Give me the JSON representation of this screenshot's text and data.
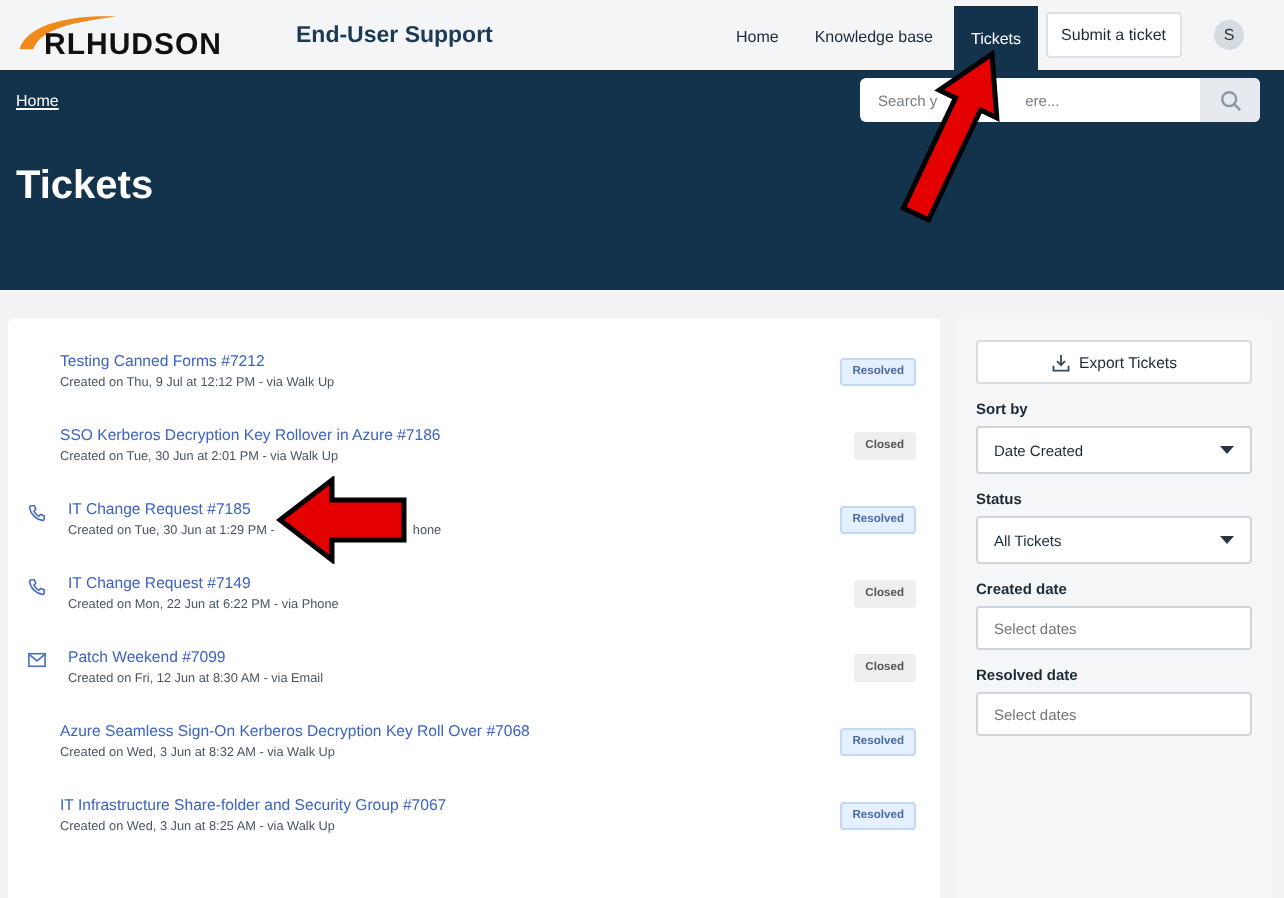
{
  "header": {
    "logo": "RLHUDSON",
    "title": "End-User Support",
    "nav": [
      {
        "label": "Home",
        "kind": "link",
        "selected": false
      },
      {
        "label": "Knowledge base",
        "kind": "link",
        "selected": false
      },
      {
        "label": "Tickets",
        "kind": "link",
        "selected": true
      },
      {
        "label": "Submit a ticket",
        "kind": "button",
        "selected": false
      }
    ],
    "avatar": "S"
  },
  "banner": {
    "breadcrumb": "Home",
    "search": {
      "placeholder_start": "Search y",
      "placeholder_end": "ere..."
    },
    "title": "Tickets"
  },
  "tickets": [
    {
      "kind": "plain",
      "title": "Testing Canned Forms #7212",
      "meta": "Created on Thu, 9 Jul at 12:12 PM - via Walk Up",
      "annotated": false,
      "status": {
        "label": "Resolved",
        "kind": "resolved"
      }
    },
    {
      "kind": "plain",
      "title": "SSO Kerberos Decryption Key Rollover in Azure #7186",
      "meta": "Created on Tue, 30 Jun at 2:01 PM - via Walk Up",
      "annotated": false,
      "status": {
        "label": "Closed",
        "kind": "closed"
      }
    },
    {
      "kind": "phone",
      "title": "IT Change Request #7185",
      "meta": "Created on Tue, 30 Jun at 1:29 PM -",
      "meta_tail": "hone",
      "annotated": true,
      "status": {
        "label": "Resolved",
        "kind": "resolved"
      }
    },
    {
      "kind": "phone",
      "title": "IT Change Request #7149",
      "meta": "Created on Mon, 22 Jun at 6:22 PM - via Phone",
      "annotated": false,
      "status": {
        "label": "Closed",
        "kind": "closed"
      }
    },
    {
      "kind": "email",
      "title": "Patch Weekend #7099",
      "meta": "Created on Fri, 12 Jun at 8:30 AM - via Email",
      "annotated": false,
      "status": {
        "label": "Closed",
        "kind": "closed"
      }
    },
    {
      "kind": "plain",
      "title": "Azure Seamless Sign-On Kerberos Decryption Key Roll Over #7068",
      "meta": "Created on Wed, 3 Jun at 8:32 AM - via Walk Up",
      "annotated": false,
      "status": {
        "label": "Resolved",
        "kind": "resolved"
      }
    },
    {
      "kind": "plain",
      "title": "IT Infrastructure Share-folder and Security Group #7067",
      "meta": "Created on Wed, 3 Jun at 8:25 AM - via Walk Up",
      "annotated": false,
      "status": {
        "label": "Resolved",
        "kind": "resolved"
      }
    }
  ],
  "sidebar": {
    "export_button": "Export Tickets",
    "filters": [
      {
        "label": "Sort by",
        "kind": "select",
        "value": "Date Created"
      },
      {
        "label": "Status",
        "kind": "select",
        "value": "All Tickets"
      },
      {
        "label": "Created date",
        "kind": "date",
        "placeholder": "Select dates"
      },
      {
        "label": "Resolved date",
        "kind": "date",
        "placeholder": "Select dates"
      }
    ]
  }
}
